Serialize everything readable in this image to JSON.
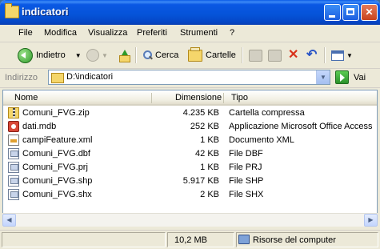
{
  "window": {
    "title": "indicatori"
  },
  "menu": {
    "file": "File",
    "modifica": "Modifica",
    "visualizza": "Visualizza",
    "preferiti": "Preferiti",
    "strumenti": "Strumenti",
    "help": "?"
  },
  "toolbar": {
    "back_label": "Indietro",
    "search_label": "Cerca",
    "folders_label": "Cartelle"
  },
  "address": {
    "label": "Indirizzo",
    "value": "D:\\indicatori",
    "go_label": "Vai"
  },
  "columns": {
    "name": "Nome",
    "size": "Dimensione",
    "type": "Tipo"
  },
  "files": [
    {
      "name": "Comuni_FVG.zip",
      "size": "4.235 KB",
      "type": "Cartella compressa",
      "icon": "zip-folder-icon"
    },
    {
      "name": "dati.mdb",
      "size": "252 KB",
      "type": "Applicazione Microsoft Office Access",
      "icon": "access-db-icon"
    },
    {
      "name": "campiFeature.xml",
      "size": "1 KB",
      "type": "Documento XML",
      "icon": "xml-file-icon"
    },
    {
      "name": "Comuni_FVG.dbf",
      "size": "42 KB",
      "type": "File DBF",
      "icon": "generic-file-icon"
    },
    {
      "name": "Comuni_FVG.prj",
      "size": "1 KB",
      "type": "File PRJ",
      "icon": "generic-file-icon"
    },
    {
      "name": "Comuni_FVG.shp",
      "size": "5.917 KB",
      "type": "File SHP",
      "icon": "generic-file-icon"
    },
    {
      "name": "Comuni_FVG.shx",
      "size": "2 KB",
      "type": "File SHX",
      "icon": "generic-file-icon"
    }
  ],
  "status": {
    "total_size": "10,2 MB",
    "location": "Risorse del computer"
  },
  "colors": {
    "titlebar": "#0553d8",
    "close_button": "#c8431e",
    "selection": "#316ac5"
  }
}
